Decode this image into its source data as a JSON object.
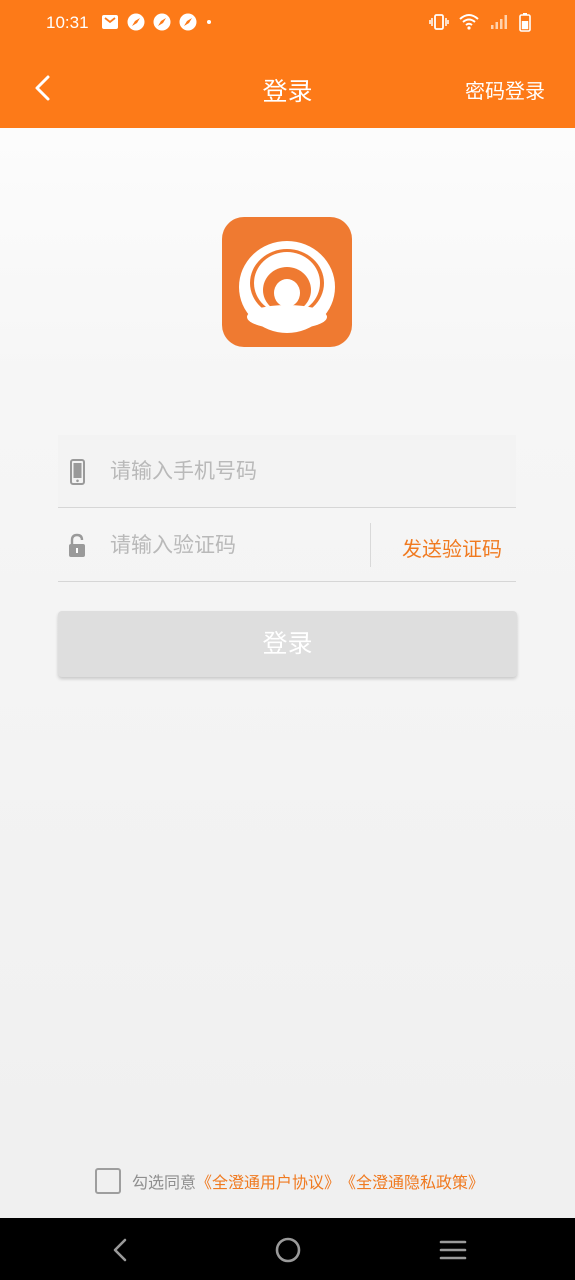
{
  "status_bar": {
    "time": "10:31",
    "icons_left": [
      "mail-icon",
      "navigation-icon",
      "navigation-icon",
      "navigation-icon",
      "dot-icon"
    ],
    "icons_right": [
      "vibrate-icon",
      "wifi-icon",
      "signal-icon",
      "battery-icon"
    ]
  },
  "app_bar": {
    "title": "登录",
    "right_action": "密码登录"
  },
  "form": {
    "phone_placeholder": "请输入手机号码",
    "code_placeholder": "请输入验证码",
    "send_code_label": "发送验证码",
    "login_label": "登录"
  },
  "agreement": {
    "prefix": "勾选同意",
    "user_agreement": "《全澄通用户协议》",
    "privacy_policy": "《全澄通隐私政策》"
  },
  "colors": {
    "brand": "#fd7a18",
    "link": "#f07a20",
    "logo_bg": "#ef7a31",
    "disabled_button": "#dedede"
  }
}
